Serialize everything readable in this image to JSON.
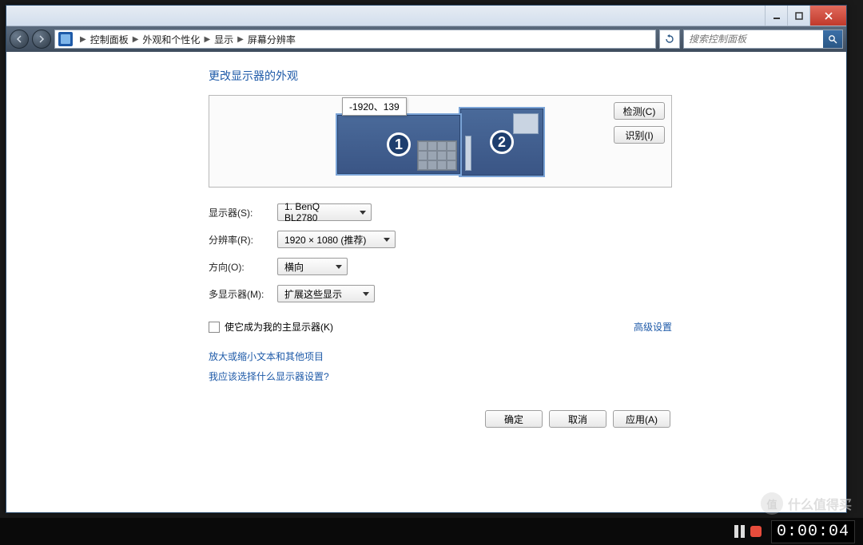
{
  "window": {
    "breadcrumb": [
      "控制面板",
      "外观和个性化",
      "显示",
      "屏幕分辨率"
    ],
    "search_placeholder": "搜索控制面板"
  },
  "page": {
    "title": "更改显示器的外观",
    "detect": "检测(C)",
    "identify": "识别(I)",
    "tooltip": "-1920、139",
    "mon1_num": "1",
    "mon2_num": "2",
    "labels": {
      "display": "显示器(S):",
      "resolution": "分辨率(R):",
      "orientation": "方向(O):",
      "multi": "多显示器(M):"
    },
    "values": {
      "display": "1. BenQ BL2780",
      "resolution": "1920 × 1080 (推荐)",
      "orientation": "横向",
      "multi": "扩展这些显示"
    },
    "make_primary": "使它成为我的主显示器(K)",
    "advanced": "高级设置",
    "link_zoom": "放大或缩小文本和其他项目",
    "link_help": "我应该选择什么显示器设置?",
    "ok": "确定",
    "cancel": "取消",
    "apply": "应用(A)"
  },
  "bottom": {
    "timer": "0:00:04",
    "watermark_text": "什么值得买",
    "watermark_badge": "值"
  }
}
